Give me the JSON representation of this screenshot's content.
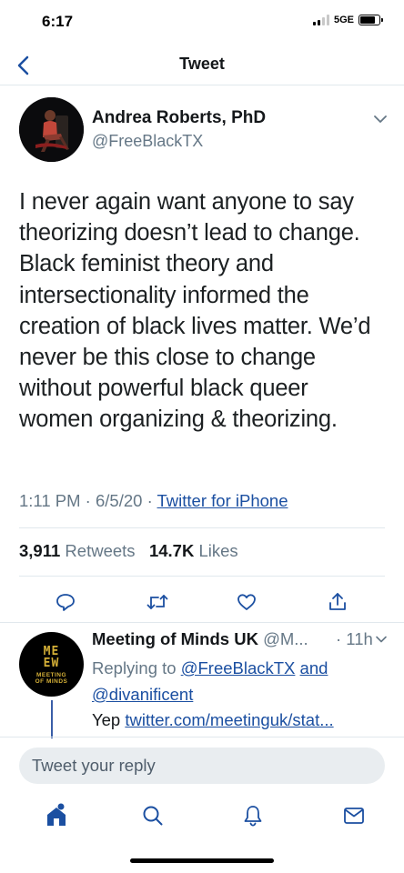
{
  "status_bar": {
    "time": "6:17",
    "network": "5GE"
  },
  "nav": {
    "title": "Tweet"
  },
  "tweet": {
    "author_name": "Andrea Roberts, PhD",
    "author_handle": "@FreeBlackTX",
    "text": "I never again want anyone to say\ntheorizing doesn’t lead to change.\nBlack feminist theory and\nintersectionality informed the\ncreation of black lives matter. We’d\nnever be this close to change\nwithout powerful black queer\nwomen organizing & theorizing.",
    "time": "1:11 PM",
    "date": "6/5/20",
    "source": "Twitter for iPhone",
    "retweets_count": "3,911",
    "retweets_label": "Retweets",
    "likes_count": "14.7K",
    "likes_label": "Likes"
  },
  "reply": {
    "avatar_logo_top": "ME",
    "avatar_logo_bottom": "EW",
    "avatar_label_1": "MEETING",
    "avatar_label_2": "OF MINDS",
    "author_name": "Meeting of Minds UK",
    "author_handle": "@M...",
    "time": "· 11h",
    "replying_prefix": "Replying to",
    "replying_user_1": "@FreeBlackTX",
    "replying_and": "and",
    "replying_user_2": "@divanificent",
    "text": "Yep",
    "link": "twitter.com/meetinguk/stat..."
  },
  "compose": {
    "placeholder": "Tweet your reply"
  },
  "colors": {
    "link": "#1b4fa1",
    "secondary_text": "#657786",
    "divider": "#e1e8ed"
  },
  "icons": {
    "back": "chevron-left-icon",
    "actions": [
      "reply-icon",
      "retweet-icon",
      "like-icon",
      "share-icon"
    ],
    "tabs": [
      "home-icon",
      "search-icon",
      "notifications-icon",
      "messages-icon"
    ]
  }
}
